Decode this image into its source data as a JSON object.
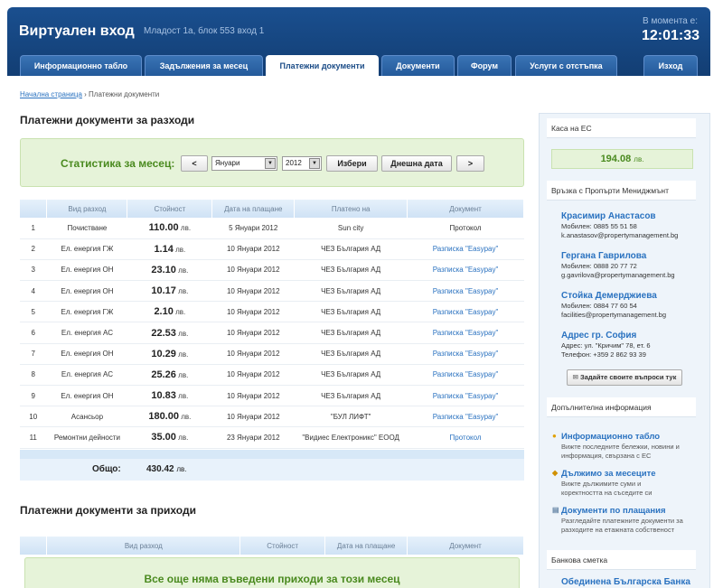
{
  "header": {
    "title": "Виртуален вход",
    "subtitle": "Младост 1а, блок 553 вход 1",
    "clock_label": "В момента е:",
    "clock": "12:01:33"
  },
  "nav": [
    "Информационно табло",
    "Задължения за месец",
    "Платежни документи",
    "Документи",
    "Форум",
    "Услуги с отстъпка",
    "Изход"
  ],
  "breadcrumb": {
    "home": "Начална страница",
    "sep": "›",
    "current": "Платежни документи"
  },
  "expenses": {
    "title": "Платежни документи за разходи",
    "stat_label": "Статистика за месец:",
    "prev": "<",
    "month": "Януари",
    "year": "2012",
    "select_btn": "Избери",
    "today_btn": "Днешна дата",
    "next": ">",
    "columns": [
      "",
      "Вид разход",
      "Стойност",
      "Дата на плащане",
      "Платено на",
      "Документ"
    ],
    "rows": [
      {
        "n": "1",
        "type": "Почистване",
        "value": "110.00",
        "cur": "лв.",
        "date": "5 Януари 2012",
        "payee": "Sun city",
        "doc": "Протокол",
        "link": false
      },
      {
        "n": "2",
        "type": "Ел. енергия ГЖ",
        "value": "1.14",
        "cur": "лв.",
        "date": "10 Януари 2012",
        "payee": "ЧЕЗ България АД",
        "doc": "Разписка \"Easypay\"",
        "link": true
      },
      {
        "n": "3",
        "type": "Ел. енергия ОН",
        "value": "23.10",
        "cur": "лв.",
        "date": "10 Януари 2012",
        "payee": "ЧЕЗ България АД",
        "doc": "Разписка \"Easypay\"",
        "link": true
      },
      {
        "n": "4",
        "type": "Ел. енергия ОН",
        "value": "10.17",
        "cur": "лв.",
        "date": "10 Януари 2012",
        "payee": "ЧЕЗ България АД",
        "doc": "Разписка \"Easypay\"",
        "link": true
      },
      {
        "n": "5",
        "type": "Ел. енергия ГЖ",
        "value": "2.10",
        "cur": "лв.",
        "date": "10 Януари 2012",
        "payee": "ЧЕЗ България АД",
        "doc": "Разписка \"Easypay\"",
        "link": true
      },
      {
        "n": "6",
        "type": "Ел. енергия АС",
        "value": "22.53",
        "cur": "лв.",
        "date": "10 Януари 2012",
        "payee": "ЧЕЗ България АД",
        "doc": "Разписка \"Easypay\"",
        "link": true
      },
      {
        "n": "7",
        "type": "Ел. енергия ОН",
        "value": "10.29",
        "cur": "лв.",
        "date": "10 Януари 2012",
        "payee": "ЧЕЗ България АД",
        "doc": "Разписка \"Easypay\"",
        "link": true
      },
      {
        "n": "8",
        "type": "Ел. енергия АС",
        "value": "25.26",
        "cur": "лв.",
        "date": "10 Януари 2012",
        "payee": "ЧЕЗ България АД",
        "doc": "Разписка \"Easypay\"",
        "link": true
      },
      {
        "n": "9",
        "type": "Ел. енергия ОН",
        "value": "10.83",
        "cur": "лв.",
        "date": "10 Януари 2012",
        "payee": "ЧЕЗ България АД",
        "doc": "Разписка \"Easypay\"",
        "link": true
      },
      {
        "n": "10",
        "type": "Асансьор",
        "value": "180.00",
        "cur": "лв.",
        "date": "10 Януари 2012",
        "payee": "\"БУЛ ЛИФТ\"",
        "doc": "Разписка \"Easypay\"",
        "link": true
      },
      {
        "n": "11",
        "type": "Ремонтни дейности",
        "value": "35.00",
        "cur": "лв.",
        "date": "23 Януари 2012",
        "payee": "\"Видиес Електроникс\" ЕООД",
        "doc": "Протокол",
        "link": true
      }
    ],
    "total_label": "Общо:",
    "total": "430.42",
    "total_cur": "лв."
  },
  "income": {
    "title": "Платежни документи за приходи",
    "columns": [
      "",
      "Вид разход",
      "Стойност",
      "Дата на плащане",
      "Документ"
    ],
    "empty": "Все още няма въведени приходи за този месец"
  },
  "sidebar": {
    "kasa_title": "Каса на ЕС",
    "kasa_value": "194.08",
    "kasa_cur": "лв.",
    "contact_title": "Връзка с Пропърти Мениджмънт",
    "contacts": [
      {
        "name": "Красимир Анастасов",
        "l1": "Мобилен: 0885 55 51 58",
        "l2": "k.anastasov@propertymanagement.bg"
      },
      {
        "name": "Гергана Гаврилова",
        "l1": "Мобилен: 0888 20 77 72",
        "l2": "g.gavrilova@propertymanagement.bg"
      },
      {
        "name": "Стойка Демерджиева",
        "l1": "Мобилен: 0884 77 60 54",
        "l2": "facilities@propertymanagement.bg"
      },
      {
        "name": "Адрес гр. София",
        "l1": "Адрес: ул. \"Кричим\" 78, ет. 6",
        "l2": "Телефон: +359 2 862 93 39"
      }
    ],
    "ask_btn": "Задайте своите въпроси тук",
    "info_title": "Допълнителна информация",
    "info": [
      {
        "link": "Информационно табло",
        "d1": "Вижте последните бележки, новини и",
        "d2": "информация, свързана с ЕС"
      },
      {
        "link": "Дължимо за месеците",
        "d1": "Вижте дължимите суми и",
        "d2": "коректността на съседите си"
      },
      {
        "link": "Документи по плащания",
        "d1": "Разгледайте платежните документи за",
        "d2": "разходите на етажната собственост"
      }
    ],
    "bank_title": "Банкова сметка",
    "bank_name": "Обединена Българска Банка"
  }
}
